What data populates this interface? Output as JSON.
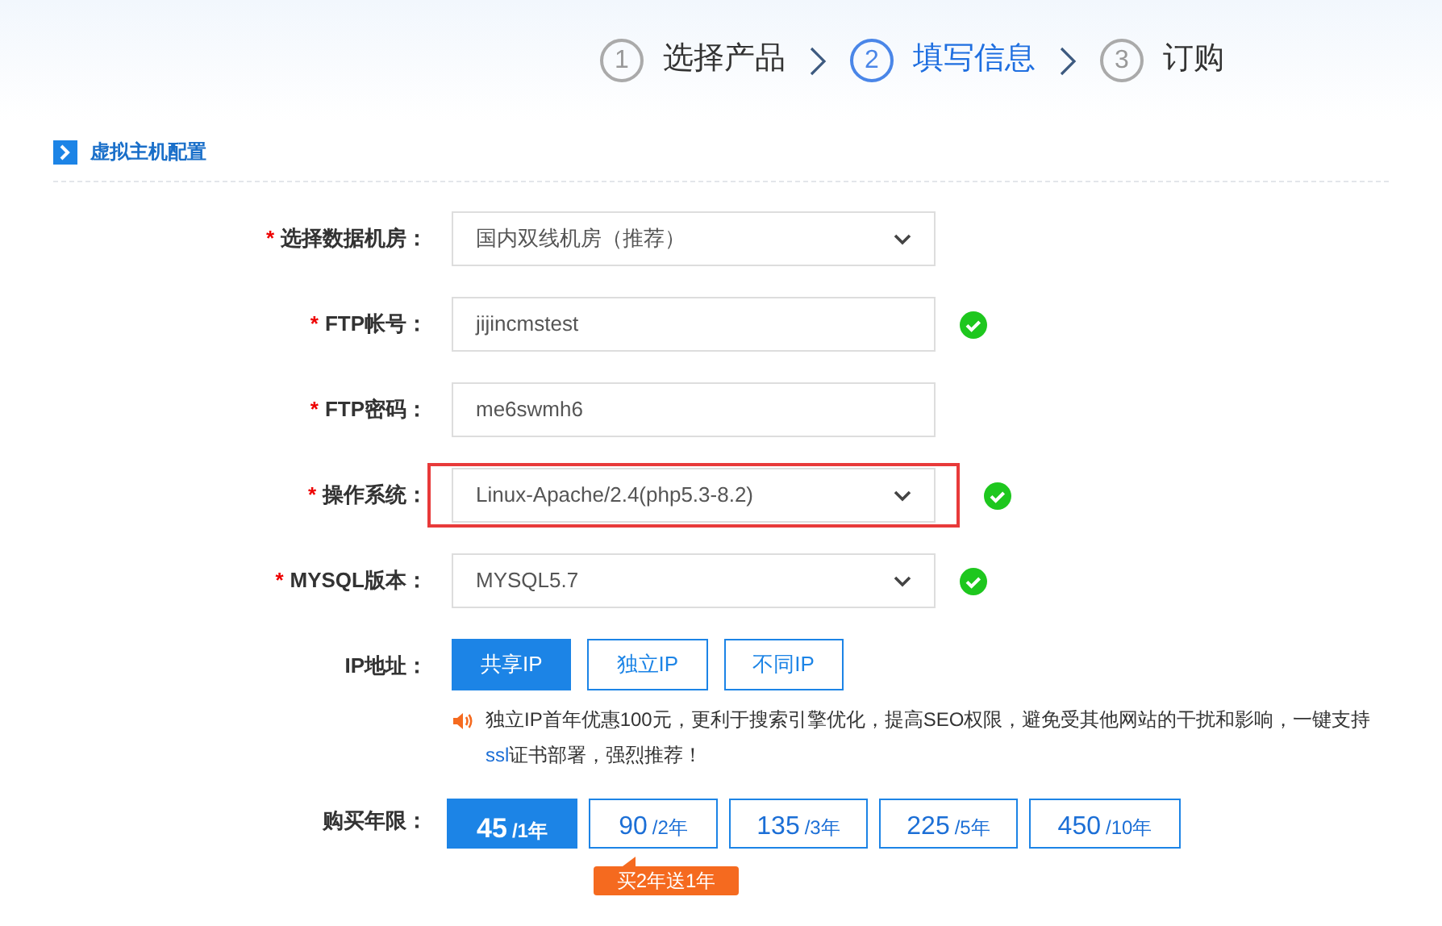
{
  "steps": [
    {
      "number": "1",
      "label": "选择产品",
      "selected": false
    },
    {
      "number": "2",
      "label": "填写信息",
      "selected": true
    },
    {
      "number": "3",
      "label": "订购",
      "selected": false
    }
  ],
  "section_title": "虚拟主机配置",
  "fields": [
    {
      "kind": "select",
      "label": "选择数据机房：",
      "required_mark": "*",
      "value": "国内双线机房（推荐）",
      "valid": false,
      "highlighted": false
    },
    {
      "kind": "input",
      "label": "FTP帐号：",
      "required_mark": "*",
      "value": "jijincmstest",
      "valid": true,
      "highlighted": false
    },
    {
      "kind": "input",
      "label": "FTP密码：",
      "required_mark": "*",
      "value": "me6swmh6",
      "valid": false,
      "highlighted": false
    },
    {
      "kind": "select",
      "label": "操作系统：",
      "required_mark": "*",
      "value": "Linux-Apache/2.4(php5.3-8.2)",
      "valid": true,
      "highlighted": true
    },
    {
      "kind": "select",
      "label": "MYSQL版本：",
      "required_mark": "*",
      "value": "MYSQL5.7",
      "valid": true,
      "highlighted": false
    }
  ],
  "ip": {
    "label": "IP地址：",
    "options": [
      {
        "label": "共享IP",
        "selected": true
      },
      {
        "label": "独立IP",
        "selected": false
      },
      {
        "label": "不同IP",
        "selected": false
      }
    ],
    "note": {
      "before": "独立IP首年优惠100元，更利于搜索引擎优化，提高SEO权限，避免受其他网站的干扰和影响，一键支持",
      "link": "ssl",
      "after": "证书部署，强烈推荐！"
    }
  },
  "term": {
    "label": "购买年限：",
    "options": [
      {
        "price": "45",
        "unit": "/1年",
        "selected": true
      },
      {
        "price": "90",
        "unit": "/2年",
        "selected": false
      },
      {
        "price": "135",
        "unit": "/3年",
        "selected": false
      },
      {
        "price": "225",
        "unit": "/5年",
        "selected": false
      },
      {
        "price": "450",
        "unit": "/10年",
        "selected": false
      }
    ],
    "promo": "买2年送1年"
  }
}
